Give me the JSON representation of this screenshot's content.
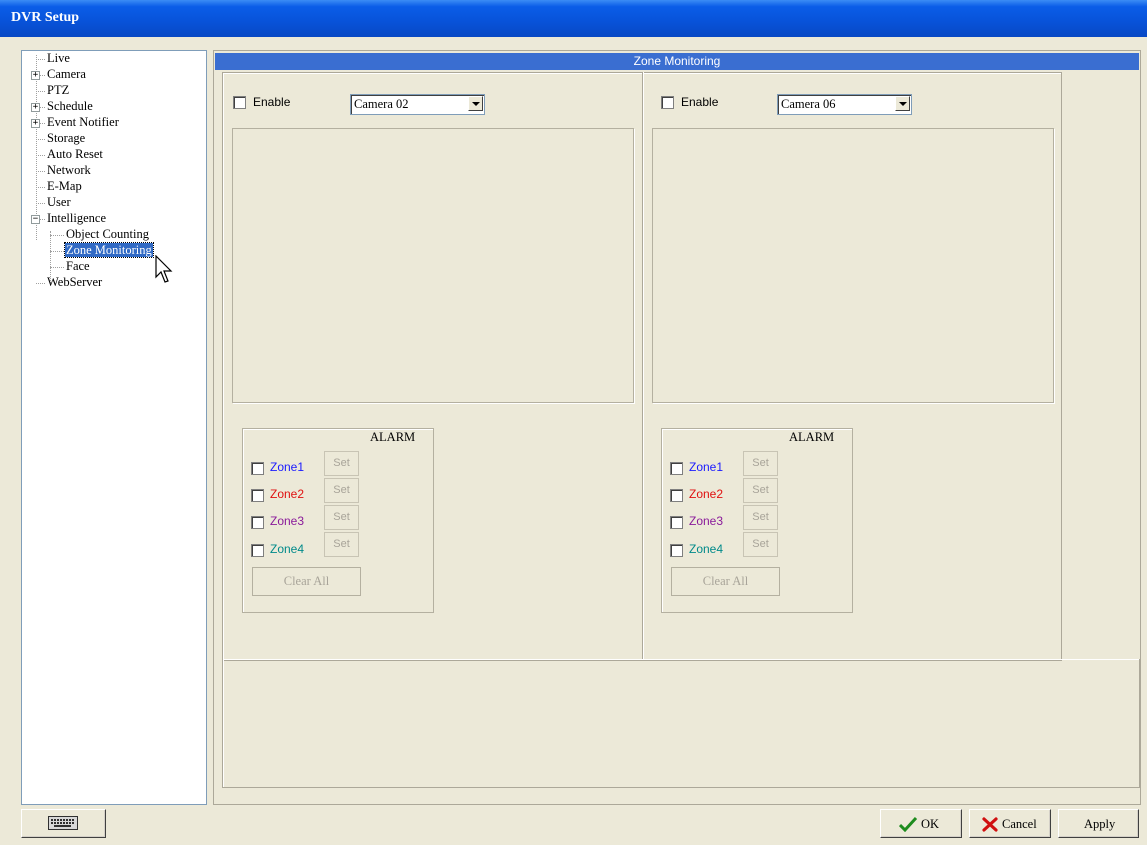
{
  "window": {
    "title": "DVR Setup"
  },
  "tree": {
    "items": [
      {
        "label": "Live"
      },
      {
        "label": "Camera"
      },
      {
        "label": "PTZ"
      },
      {
        "label": "Schedule"
      },
      {
        "label": "Event Notifier"
      },
      {
        "label": "Storage"
      },
      {
        "label": "Auto Reset"
      },
      {
        "label": "Network"
      },
      {
        "label": "E-Map"
      },
      {
        "label": "User"
      },
      {
        "label": "Intelligence"
      },
      {
        "label": "Object Counting"
      },
      {
        "label": "Zone Monitoring",
        "selected": true
      },
      {
        "label": "Face"
      },
      {
        "label": "WebServer"
      }
    ]
  },
  "panel": {
    "header": "Zone Monitoring"
  },
  "left": {
    "enable_label": "Enable",
    "camera": "Camera 02",
    "alarm_title": "ALARM",
    "zones": [
      "Zone1",
      "Zone2",
      "Zone3",
      "Zone4"
    ],
    "set_label": "Set",
    "clear_label": "Clear All"
  },
  "right": {
    "enable_label": "Enable",
    "camera": "Camera 06",
    "alarm_title": "ALARM",
    "zones": [
      "Zone1",
      "Zone2",
      "Zone3",
      "Zone4"
    ],
    "set_label": "Set",
    "clear_label": "Clear All"
  },
  "zone_colors": [
    "#1a1aff",
    "#e01010",
    "#8a1a9a",
    "#008a8a"
  ],
  "buttons": {
    "ok": "OK",
    "cancel": "Cancel",
    "apply": "Apply"
  },
  "icons": {
    "keyboard": "keyboard-icon",
    "ok": "checkmark-icon",
    "cancel": "x-icon"
  }
}
